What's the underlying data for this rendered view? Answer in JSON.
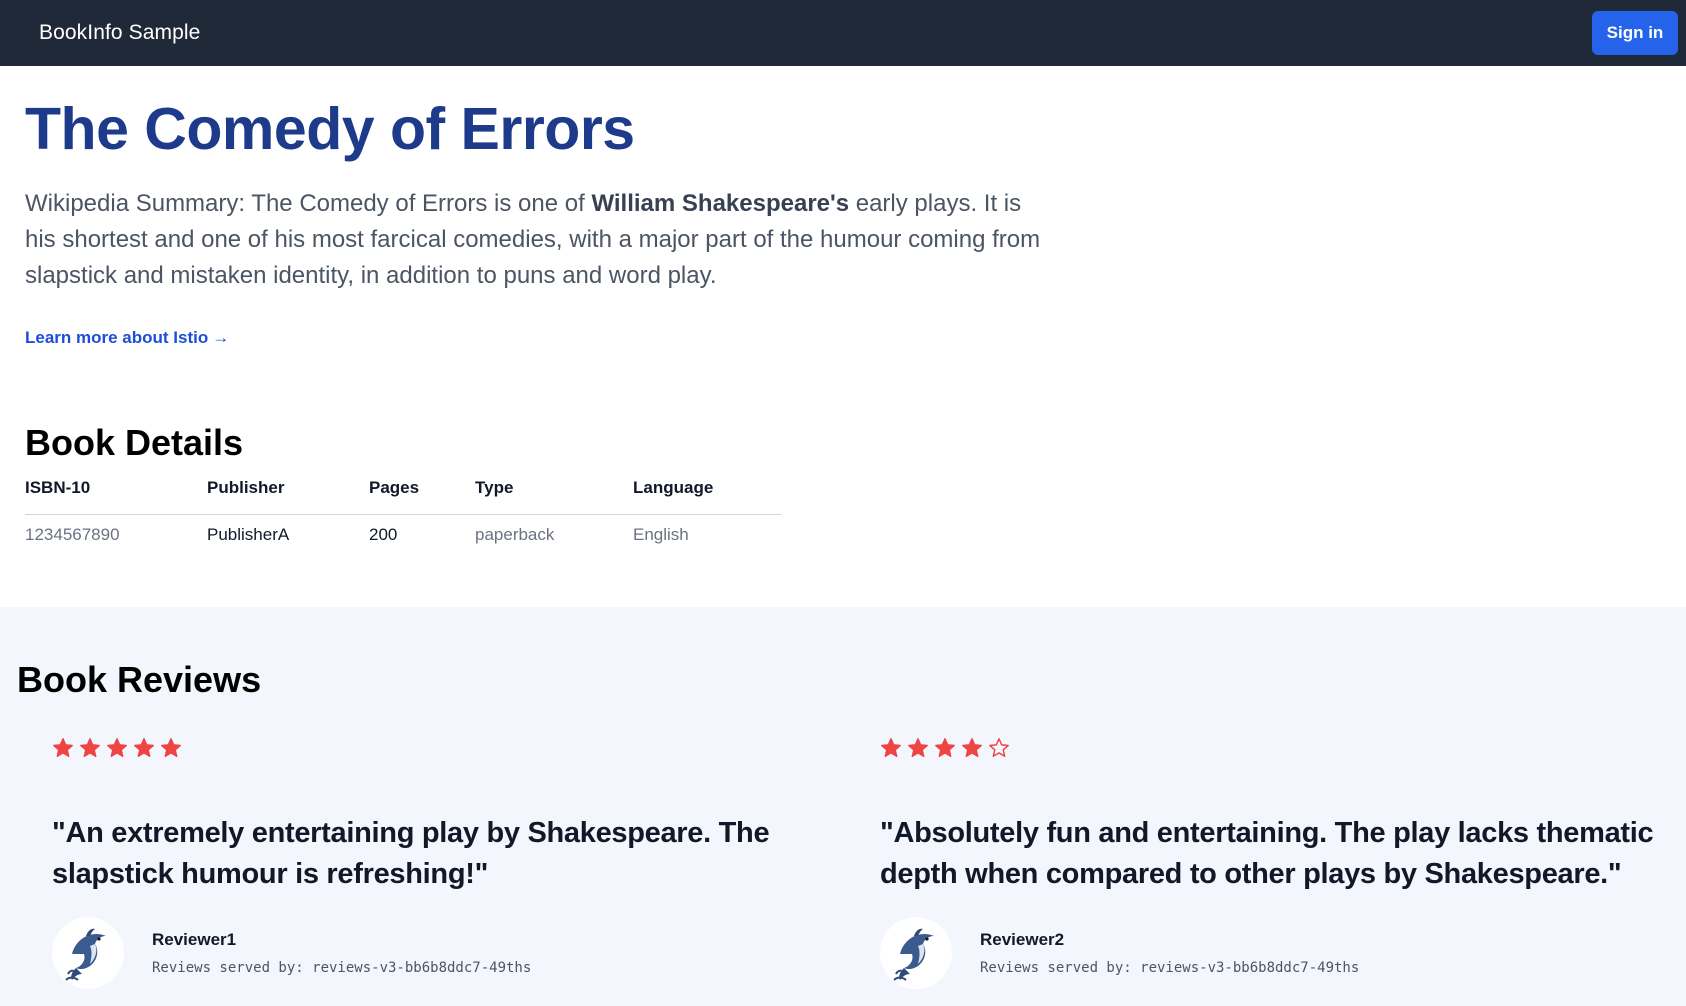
{
  "navbar": {
    "brand": "BookInfo Sample",
    "signin_label": "Sign in"
  },
  "hero": {
    "title": "The Comedy of Errors",
    "summary_prefix": "Wikipedia Summary: The Comedy of Errors is one of ",
    "summary_bold": "William Shakespeare's",
    "summary_suffix": " early plays. It is his shortest and one of his most farcical comedies, with a major part of the humour coming from slapstick and mistaken identity, in addition to puns and word play.",
    "learn_more": "Learn more about Istio",
    "learn_more_arrow": "→"
  },
  "details": {
    "title": "Book Details",
    "columns": [
      "ISBN-10",
      "Publisher",
      "Pages",
      "Type",
      "Language"
    ],
    "row": [
      "1234567890",
      "PublisherA",
      "200",
      "paperback",
      "English"
    ]
  },
  "reviews": {
    "title": "Book Reviews",
    "star_color": "#ef4444",
    "items": [
      {
        "rating": 5,
        "quote": "\"An extremely entertaining play by Shakespeare. The slapstick humour is refreshing!\"",
        "reviewer": "Reviewer1",
        "served_by": "Reviews served by: reviews-v3-bb6b8ddc7-49ths",
        "avatar_icon": "dolphin-icon"
      },
      {
        "rating": 4,
        "quote": "\"Absolutely fun and entertaining. The play lacks thematic depth when compared to other plays by Shakespeare.\"",
        "reviewer": "Reviewer2",
        "served_by": "Reviews served by: reviews-v3-bb6b8ddc7-49ths",
        "avatar_icon": "dolphin-icon"
      }
    ]
  }
}
